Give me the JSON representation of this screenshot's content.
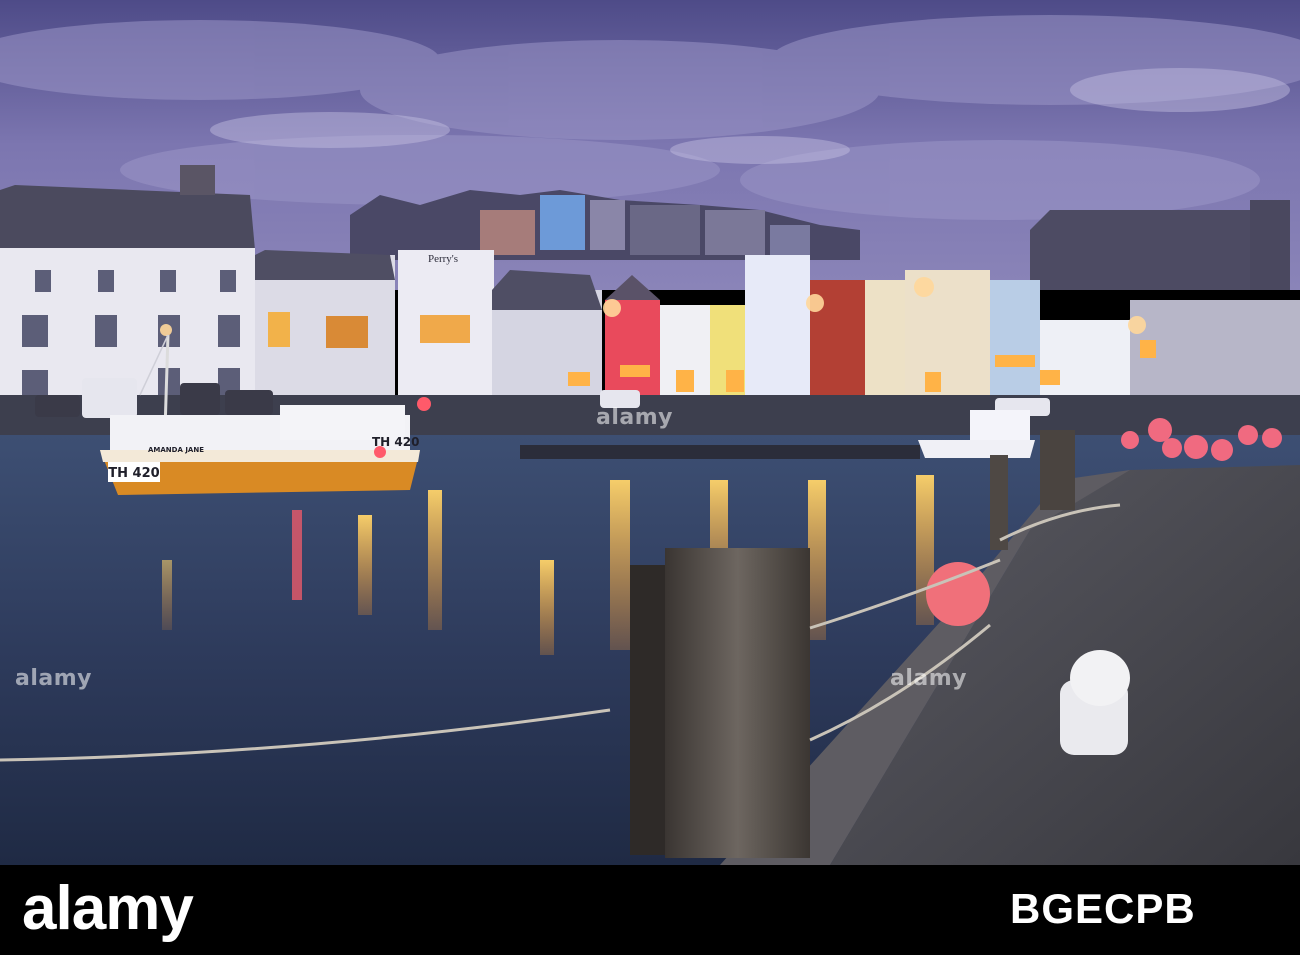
{
  "photo": {
    "alt": "Weymouth harbour at dusk with fishing boats and lit quayside buildings",
    "colors": {
      "sky": "#5f5a96",
      "water": "#2e3b5a",
      "quay": "#4a4a4f",
      "boat_hull": "#d88a24",
      "buoy": "#e85a6a"
    }
  },
  "sign": {
    "perrys": "Perry's"
  },
  "boat": {
    "name": "AMANDA JANE",
    "reg_bow": "TH 420",
    "reg_cabin": "TH 420"
  },
  "watermark": {
    "text": "alamy"
  },
  "footer": {
    "logo": "alamy",
    "code": "BGECPB"
  }
}
